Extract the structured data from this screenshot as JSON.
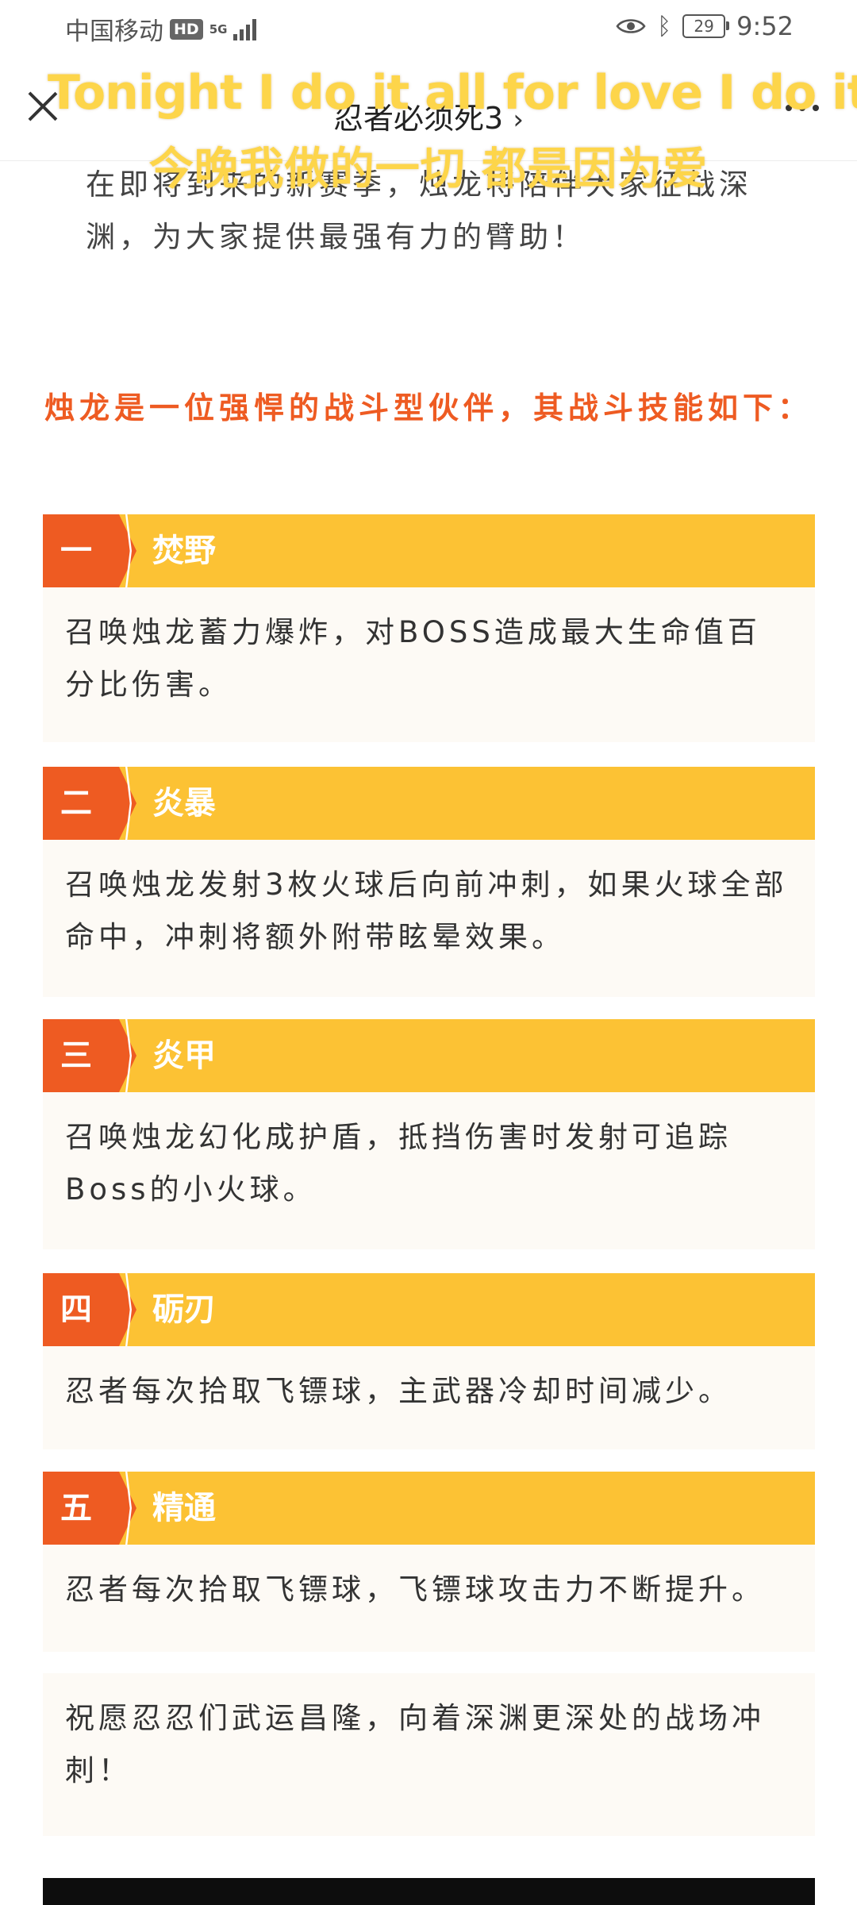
{
  "status_bar": {
    "carrier": "中国移动",
    "hd": "HD",
    "network": "5G",
    "battery": "29",
    "time": "9:52"
  },
  "header": {
    "title": "忍者必须死3",
    "title_chevron": "›"
  },
  "lyrics": {
    "english": "Tonight I do it all for love I do it…",
    "chinese": "今晚我做的一切 都是因为爱"
  },
  "article": {
    "intro": "在即将到来的新赛季，烛龙将陪伴大家征战深渊，为大家提供最强有力的臂助！",
    "headline": "烛龙是一位强悍的战斗型伙伴，其战斗技能如下：",
    "skills": [
      {
        "num": "一",
        "name": "焚野",
        "desc": "召唤烛龙蓄力爆炸，对BOSS造成最大生命值百分比伤害。"
      },
      {
        "num": "二",
        "name": "炎暴",
        "desc": "召唤烛龙发射3枚火球后向前冲刺，如果火球全部命中，冲刺将额外附带眩晕效果。"
      },
      {
        "num": "三",
        "name": "炎甲",
        "desc": "召唤烛龙幻化成护盾，抵挡伤害时发射可追踪Boss的小火球。"
      },
      {
        "num": "四",
        "name": "砺刃",
        "desc": "忍者每次拾取飞镖球，主武器冷却时间减少。"
      },
      {
        "num": "五",
        "name": "精通",
        "desc": "忍者每次拾取飞镖球，飞镖球攻击力不断提升。"
      }
    ],
    "closing": "祝愿忍忍们武运昌隆，向着深渊更深处的战场冲刺！"
  },
  "colors": {
    "accent_orange": "#ee5b22",
    "accent_yellow": "#fcc234",
    "lyric_yellow": "#fdd54a"
  }
}
